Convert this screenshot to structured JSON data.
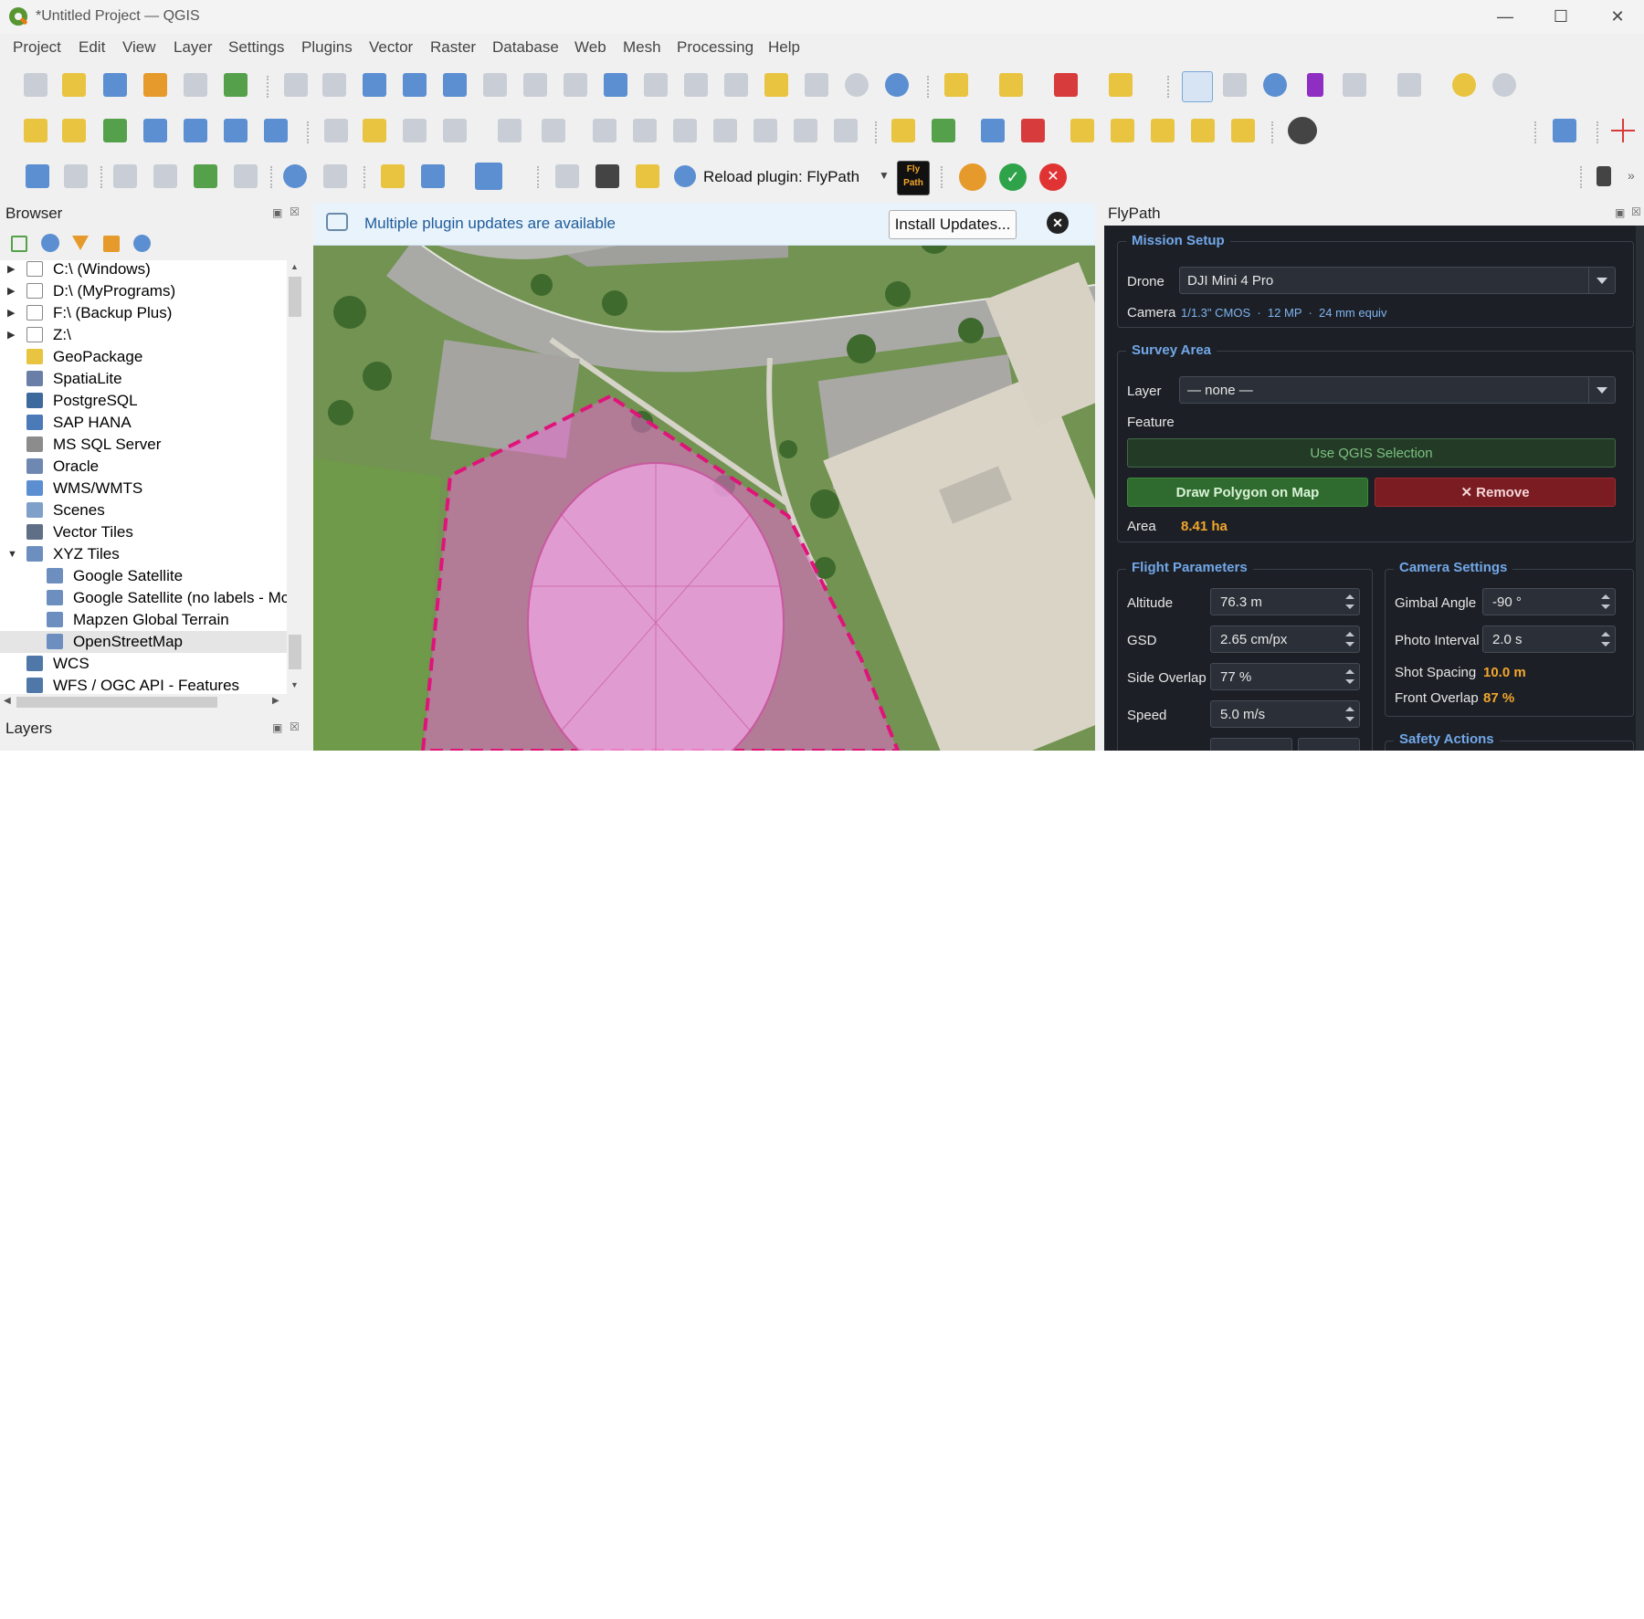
{
  "window": {
    "title": "*Untitled Project — QGIS",
    "minimize_icon": "minimize-icon",
    "maximize_icon": "maximize-icon",
    "close_icon": "close-icon"
  },
  "menu": [
    "Project",
    "Edit",
    "View",
    "Layer",
    "Settings",
    "Plugins",
    "Vector",
    "Raster",
    "Database",
    "Web",
    "Mesh",
    "Processing",
    "Help"
  ],
  "toolbar3": {
    "reload_label": "Reload plugin: FlyPath",
    "flypath_icon_text_1": "Fly",
    "flypath_icon_text_2": "Path"
  },
  "browser": {
    "title": "Browser",
    "items": [
      {
        "label": "C:\\ (Windows)",
        "icon": "folder-icon",
        "expand": "▶"
      },
      {
        "label": "D:\\ (MyPrograms)",
        "icon": "folder-icon",
        "expand": "▶"
      },
      {
        "label": "F:\\ (Backup Plus)",
        "icon": "folder-icon",
        "expand": "▶"
      },
      {
        "label": "Z:\\",
        "icon": "folder-icon",
        "expand": "▶"
      },
      {
        "label": "GeoPackage",
        "icon": "geopackage-icon"
      },
      {
        "label": "SpatiaLite",
        "icon": "spatialite-icon"
      },
      {
        "label": "PostgreSQL",
        "icon": "postgresql-icon"
      },
      {
        "label": "SAP HANA",
        "icon": "sap-hana-icon"
      },
      {
        "label": "MS SQL Server",
        "icon": "mssql-icon"
      },
      {
        "label": "Oracle",
        "icon": "oracle-icon"
      },
      {
        "label": "WMS/WMTS",
        "icon": "wms-icon"
      },
      {
        "label": "Scenes",
        "icon": "scenes-icon"
      },
      {
        "label": "Vector Tiles",
        "icon": "vector-tiles-icon"
      },
      {
        "label": "XYZ Tiles",
        "icon": "xyz-tiles-icon",
        "expand": "▼"
      },
      {
        "label": "Google Satellite",
        "icon": "tiles-icon",
        "child": true
      },
      {
        "label": "Google Satellite (no labels - Mc",
        "icon": "tiles-icon",
        "child": true
      },
      {
        "label": "Mapzen Global Terrain",
        "icon": "tiles-icon",
        "child": true
      },
      {
        "label": "OpenStreetMap",
        "icon": "tiles-icon",
        "child": true,
        "selected": true
      },
      {
        "label": "WCS",
        "icon": "wcs-icon"
      },
      {
        "label": "WFS / OGC API - Features",
        "icon": "wfs-icon"
      }
    ]
  },
  "layers": {
    "title": "Layers"
  },
  "message_bar": {
    "text": "Multiple plugin updates are available",
    "button": "Install Updates..."
  },
  "flypath": {
    "title": "FlyPath",
    "mission_setup": {
      "title": "Mission Setup",
      "drone_label": "Drone",
      "drone_value": "DJI Mini 4 Pro",
      "camera_label": "Camera",
      "camera_specs": "1/1.3\" CMOS  ·  12 MP  ·  24 mm equiv"
    },
    "survey_area": {
      "title": "Survey Area",
      "layer_label": "Layer",
      "layer_value": "— none —",
      "feature_label": "Feature",
      "use_selection": "Use QGIS Selection",
      "draw_polygon": "Draw Polygon on Map",
      "remove": "✕ Remove",
      "area_label": "Area",
      "area_value": "8.41 ha"
    },
    "flight_params": {
      "title": "Flight Parameters",
      "altitude_label": "Altitude",
      "altitude_value": "76.3 m",
      "gsd_label": "GSD",
      "gsd_value": "2.65 cm/px",
      "side_overlap_label": "Side Overlap",
      "side_overlap_value": "77 %",
      "speed_label": "Speed",
      "speed_value": "5.0 m/s"
    },
    "camera_settings": {
      "title": "Camera Settings",
      "gimbal_label": "Gimbal Angle",
      "gimbal_value": "-90 °",
      "photo_interval_label": "Photo Interval",
      "photo_interval_value": "2.0 s",
      "shot_spacing_label": "Shot Spacing",
      "shot_spacing_value": "10.0 m",
      "front_overlap_label": "Front Overlap",
      "front_overlap_value": "87 %"
    },
    "safety": {
      "title": "Safety Actions"
    }
  },
  "colors": {
    "polygon_fill": "#e86ad0",
    "polygon_stroke": "#e0137a",
    "fp_bg": "#1c2026",
    "fp_accent": "#72a7e8",
    "fp_highlight": "#f3a62c"
  }
}
